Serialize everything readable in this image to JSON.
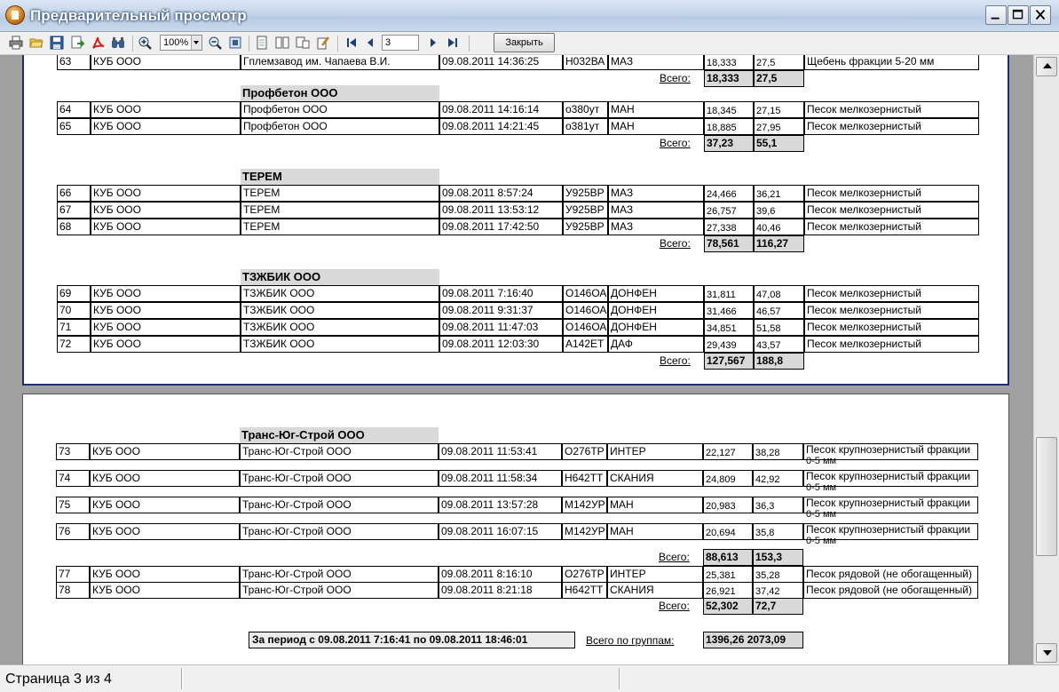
{
  "window": {
    "title": "Предварительный просмотр"
  },
  "toolbar": {
    "zoom": "100%",
    "page_input": "3",
    "close_label": "Закрыть"
  },
  "status": {
    "page_text": "Страница 3 из 4"
  },
  "report": {
    "total_label": "Всего:",
    "page1": {
      "row63": [
        "63",
        "КУБ ООО",
        "Гплемзавод им. Чапаева В.И.",
        "09.08.2011 14:36:25",
        "Н032ВА",
        "МАЗ",
        "18,333",
        "27,5",
        "Щебень фракции 5-20 мм"
      ],
      "total63": [
        "18,333",
        "27,5"
      ],
      "groups": [
        {
          "name": "Профбетон ООО",
          "rows": [
            [
              "64",
              "КУБ ООО",
              "Профбетон ООО",
              "09.08.2011 14:16:14",
              "о380ут",
              "МАН",
              "18,345",
              "27,15",
              "Песок мелкозернистый"
            ],
            [
              "65",
              "КУБ ООО",
              "Профбетон ООО",
              "09.08.2011 14:21:45",
              "о381ут",
              "МАН",
              "18,885",
              "27,95",
              "Песок мелкозернистый"
            ]
          ],
          "total": [
            "37,23",
            "55,1"
          ]
        },
        {
          "name": "ТЕРЕМ",
          "rows": [
            [
              "66",
              "КУБ ООО",
              "ТЕРЕМ",
              "09.08.2011 8:57:24",
              "У925ВР",
              "МАЗ",
              "24,466",
              "36,21",
              "Песок мелкозернистый"
            ],
            [
              "67",
              "КУБ ООО",
              "ТЕРЕМ",
              "09.08.2011 13:53:12",
              "У925ВР",
              "МАЗ",
              "26,757",
              "39,6",
              "Песок мелкозернистый"
            ],
            [
              "68",
              "КУБ ООО",
              "ТЕРЕМ",
              "09.08.2011 17:42:50",
              "У925ВР",
              "МАЗ",
              "27,338",
              "40,46",
              "Песок мелкозернистый"
            ]
          ],
          "total": [
            "78,561",
            "116,27"
          ]
        },
        {
          "name": "ТЗЖБИК ООО",
          "rows": [
            [
              "69",
              "КУБ ООО",
              "ТЗЖБИК ООО",
              "09.08.2011 7:16:40",
              "О146ОА",
              "ДОНФЕН",
              "31,811",
              "47,08",
              "Песок мелкозернистый"
            ],
            [
              "70",
              "КУБ ООО",
              "ТЗЖБИК ООО",
              "09.08.2011 9:31:37",
              "О146ОА",
              "ДОНФЕН",
              "31,466",
              "46,57",
              "Песок мелкозернистый"
            ],
            [
              "71",
              "КУБ ООО",
              "ТЗЖБИК ООО",
              "09.08.2011 11:47:03",
              "О146ОА",
              "ДОНФЕН",
              "34,851",
              "51,58",
              "Песок мелкозернистый"
            ],
            [
              "72",
              "КУБ ООО",
              "ТЗЖБИК ООО",
              "09.08.2011 12:03:30",
              "А142ЕТ",
              "ДАФ",
              "29,439",
              "43,57",
              "Песок мелкозернистый"
            ]
          ],
          "total": [
            "127,567",
            "188,8"
          ]
        }
      ]
    },
    "page2": {
      "group_name": "Транс-Юг-Строй  ООО",
      "rows": [
        [
          "73",
          "КУБ ООО",
          "Транс-Юг-Строй  ООО",
          "09.08.2011 11:53:41",
          "О276ТР",
          "ИНТЕР",
          "22,127",
          "38,28",
          "Песок крупнозернистый фракции",
          "0-5 мм"
        ],
        [
          "74",
          "КУБ ООО",
          "Транс-Юг-Строй  ООО",
          "09.08.2011 11:58:34",
          "Н642ТТ",
          "СКАНИЯ",
          "24,809",
          "42,92",
          "Песок крупнозернистый фракции",
          "0-5 мм"
        ],
        [
          "75",
          "КУБ ООО",
          "Транс-Юг-Строй  ООО",
          "09.08.2011 13:57:28",
          "М142УР",
          "МАН",
          "20,983",
          "36,3",
          "Песок крупнозернистый фракции",
          "0-5 мм"
        ],
        [
          "76",
          "КУБ ООО",
          "Транс-Юг-Строй  ООО",
          "09.08.2011 16:07:15",
          "М142УР",
          "МАН",
          "20,694",
          "35,8",
          "Песок крупнозернистый фракции",
          "0-5 мм"
        ]
      ],
      "total1": [
        "88,613",
        "153,3"
      ],
      "rows2": [
        [
          "77",
          "КУБ ООО",
          "Транс-Юг-Строй  ООО",
          "09.08.2011 8:16:10",
          "О276ТР",
          "ИНТЕР",
          "25,381",
          "35,28",
          "Песок рядовой (не обогащенный)"
        ],
        [
          "78",
          "КУБ ООО",
          "Транс-Юг-Строй  ООО",
          "09.08.2011 8:21:18",
          "Н642ТТ",
          "СКАНИЯ",
          "26,921",
          "37,42",
          "Песок рядовой (не обогащенный)"
        ]
      ],
      "total2": [
        "52,302",
        "72,7"
      ],
      "period_label": "За период с 09.08.2011 7:16:41 по 09.08.2011 18:46:01",
      "grand_label": "Всего по группам:",
      "grand_values": "1396,26  2073,09"
    }
  }
}
